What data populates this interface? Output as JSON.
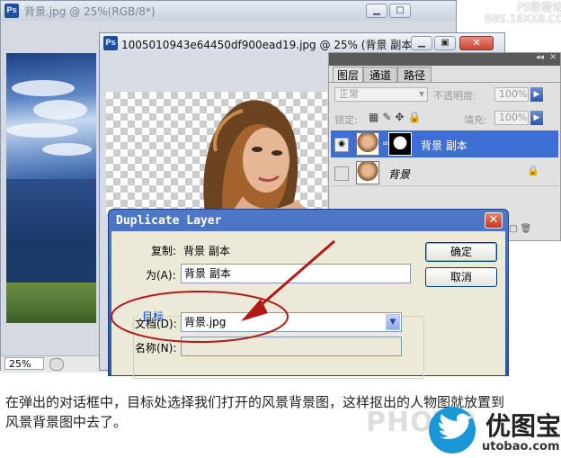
{
  "window1": {
    "app_icon": "Ps",
    "title": "背景.jpg @ 25%(RGB/8*)",
    "zoom": "25%"
  },
  "watermark_top": {
    "line1": "PS教程论坛",
    "line2": "BBS.16XX8.COM"
  },
  "window2": {
    "app_icon": "Ps",
    "title": "1005010943e64450df900ead19.jpg @ 25% (背景 副本,..."
  },
  "layers_panel": {
    "tabs": [
      "图层",
      "通道",
      "路径"
    ],
    "blend_mode": "正常",
    "opacity_label": "不透明度:",
    "opacity_value": "100%",
    "lock_label": "锁定:",
    "fill_label": "填充:",
    "fill_value": "100%",
    "layers": [
      {
        "name": "背景 副本",
        "selected": true,
        "visible": true
      },
      {
        "name": "背景",
        "selected": false,
        "visible": false,
        "locked": true
      }
    ]
  },
  "dialog": {
    "title": "Duplicate Layer",
    "copy_label": "复制:",
    "copy_value": "背景 副本",
    "as_label": "为(A):",
    "as_value": "背景 副本",
    "group_label": "目标",
    "document_label": "文档(D):",
    "document_value": "背景.jpg",
    "name_label": "名称(N):",
    "name_value": "",
    "ok_label": "确定",
    "cancel_label": "取消"
  },
  "caption": "在弹出的对话框中，目标处选择我们打开的风景背景图，这样抠出的人物图就放置到风景背景图中去了。",
  "bottom_watermark": "PHOTO",
  "logo": {
    "text": "优图宝",
    "url": "utobao.com"
  },
  "colors": {
    "annotation_red": "#b21a1a",
    "selected_layer": "#3d6ed2",
    "dialog_title_blue": "#2e59b4"
  }
}
